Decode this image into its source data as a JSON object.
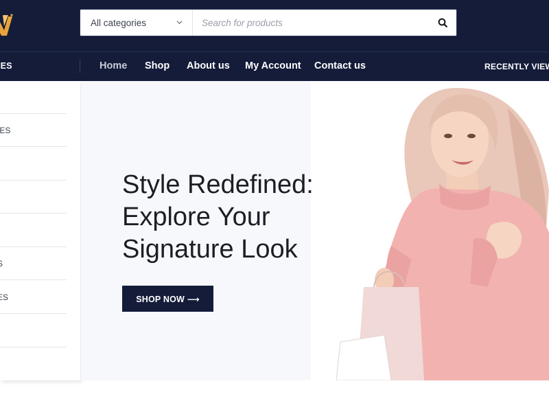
{
  "header": {
    "search": {
      "category_label": "All categories",
      "placeholder": "Search for products"
    }
  },
  "nav": {
    "all_categories_label": "IES",
    "links": [
      {
        "label": "Home"
      },
      {
        "label": "Shop"
      },
      {
        "label": "About us"
      },
      {
        "label": "My Account"
      },
      {
        "label": "Contact us"
      }
    ],
    "recently_viewed_label": "RECENTLY VIEWED"
  },
  "sidebar": {
    "items": [
      {
        "label": ""
      },
      {
        "label": "IES"
      },
      {
        "label": ""
      },
      {
        "label": ""
      },
      {
        "label": ""
      },
      {
        "label": "S"
      },
      {
        "label": "ES"
      },
      {
        "label": ""
      }
    ]
  },
  "hero": {
    "title_lines": [
      "Style Redefined:",
      "Explore Your",
      "Signature Look"
    ],
    "cta_label": "SHOP NOW ⟶"
  },
  "colors": {
    "header_bg": "#141c3a",
    "logo_accent": "#e8a33a",
    "hero_bg": "#f7f8fc",
    "sweater_pink": "#f2b3b0"
  },
  "icons": {
    "logo": "brand-logo-icon",
    "category_dropdown": "chevron-down-icon",
    "search": "search-icon"
  }
}
